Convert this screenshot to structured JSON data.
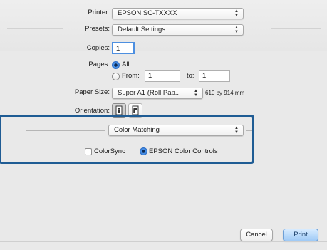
{
  "printer": {
    "label": "Printer:",
    "value": "EPSON SC-TXXXX"
  },
  "presets": {
    "label": "Presets:",
    "value": "Default Settings"
  },
  "copies": {
    "label": "Copies:",
    "value": "1"
  },
  "pages": {
    "label": "Pages:",
    "all_label": "All",
    "from_label": "From:",
    "from_value": "1",
    "to_label": "to:",
    "to_value": "1",
    "selected": "All"
  },
  "paper_size": {
    "label": "Paper Size:",
    "value": "Super A1 (Roll Pap...",
    "dimensions": "610 by 914 mm"
  },
  "orientation": {
    "label": "Orientation:",
    "selected": "portrait"
  },
  "panel": {
    "value": "Color Matching"
  },
  "color_options": {
    "colorsync_label": "ColorSync",
    "epson_label": "EPSON Color Controls",
    "selected": "EPSON Color Controls"
  },
  "buttons": {
    "cancel": "Cancel",
    "print": "Print"
  },
  "colors": {
    "highlight_border": "#1f5c94",
    "accent": "#2f74d0"
  }
}
